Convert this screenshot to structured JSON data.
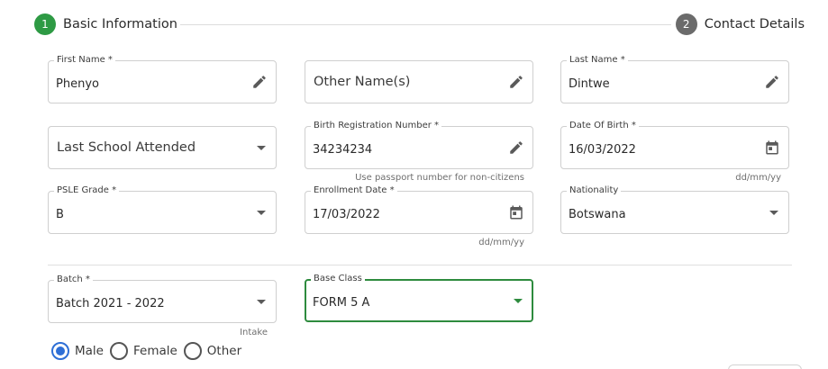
{
  "stepper": {
    "steps": [
      {
        "number": "1",
        "label": "Basic Information",
        "status": "active",
        "color": "#2e9a44"
      },
      {
        "number": "2",
        "label": "Contact Details",
        "status": "inactive",
        "color": "#6b6b6b"
      }
    ]
  },
  "fields": {
    "first_name": {
      "label": "First Name *",
      "value": "Phenyo",
      "icon": "pencil-icon"
    },
    "other_names": {
      "placeholder": "Other Name(s)",
      "icon": "pencil-icon"
    },
    "last_name": {
      "label": "Last Name *",
      "value": "Dintwe",
      "icon": "pencil-icon"
    },
    "last_school": {
      "placeholder": "Last School Attended",
      "icon": "dropdown-arrow-icon"
    },
    "birth_reg": {
      "label": "Birth Registration Number *",
      "value": "34234234",
      "icon": "pencil-icon",
      "helper": "Use passport number for non-citizens"
    },
    "dob": {
      "label": "Date Of Birth *",
      "value": "16/03/2022",
      "icon": "calendar-icon",
      "helper": "dd/mm/yy"
    },
    "psle_grade": {
      "label": "PSLE Grade *",
      "value": "B",
      "icon": "dropdown-arrow-icon"
    },
    "enrollment_date": {
      "label": "Enrollment Date *",
      "value": "17/03/2022",
      "icon": "calendar-icon",
      "helper": "dd/mm/yy"
    },
    "nationality": {
      "label": "Nationality",
      "value": "Botswana",
      "icon": "dropdown-arrow-icon"
    },
    "batch": {
      "label": "Batch *",
      "value": "Batch 2021 - 2022",
      "icon": "dropdown-arrow-icon",
      "helper": "Intake"
    },
    "base_class": {
      "label": "Base Class",
      "value": "FORM 5 A",
      "icon": "dropdown-arrow-icon",
      "focused": true
    }
  },
  "gender": {
    "options": [
      {
        "label": "Male",
        "checked": true
      },
      {
        "label": "Female",
        "checked": false
      },
      {
        "label": "Other",
        "checked": false
      }
    ]
  },
  "colors": {
    "accent_green": "#2e8b3e",
    "radio_blue": "#2e6fd6"
  }
}
